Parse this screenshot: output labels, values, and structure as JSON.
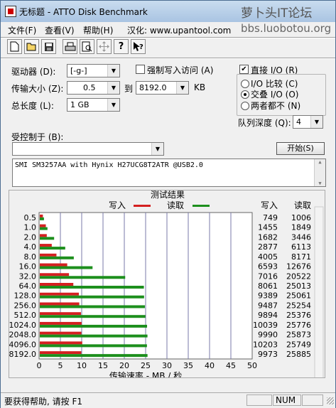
{
  "window": {
    "title": "无标题 - ATTO Disk Benchmark",
    "watermark": "萝卜头IT论坛",
    "watermark_url": "bbs.luobotou.org"
  },
  "menu": [
    "文件(F)",
    "查看(V)",
    "帮助(H)",
    "汉化: www.upantool.com"
  ],
  "toolbar_icons": [
    "new-file-icon",
    "open-folder-icon",
    "save-icon",
    "print-icon",
    "print-preview-icon",
    "move-icon",
    "help-icon",
    "context-help-icon"
  ],
  "form": {
    "drive_label": "驱动器 (D):",
    "drive_value": "[-g-]",
    "force_write_label": "强制写入访问 (A)",
    "force_write_checked": false,
    "direct_io_label": "直接 I/O (R)",
    "direct_io_checked": true,
    "transfer_label": "传输大小 (Z):",
    "transfer_from": "0.5",
    "to_label": "到",
    "transfer_to": "8192.0",
    "kb_label": "KB",
    "length_label": "总长度 (L):",
    "length_value": "1 GB",
    "io_compare_label": "I/O 比较 (C)",
    "overlapped_label": "交叠 I/O (O)",
    "neither_label": "两者都不 (N)",
    "selected_mode": "overlapped",
    "queue_label": "队列深度 (Q):",
    "queue_value": "4",
    "controlled_label": "受控制于 (B):",
    "controlled_value": "",
    "start_button": "开始(S)",
    "description": "SMI SM3257AA with Hynix H27UCG8T2ATR @USB2.0"
  },
  "chart_data": {
    "type": "bar",
    "title": "测试结果",
    "legend": [
      "写入",
      "读取"
    ],
    "colors": {
      "write": "#d42020",
      "read": "#1d8f1d"
    },
    "categories": [
      "0.5",
      "1.0",
      "2.0",
      "4.0",
      "8.0",
      "16.0",
      "32.0",
      "64.0",
      "128.0",
      "256.0",
      "512.0",
      "1024.0",
      "2048.0",
      "4096.0",
      "8192.0"
    ],
    "series": [
      {
        "name": "写入",
        "values": [
          749,
          1455,
          1682,
          2877,
          4005,
          6593,
          7016,
          8061,
          9389,
          9487,
          9894,
          10039,
          9990,
          10203,
          9973
        ]
      },
      {
        "name": "读取",
        "values": [
          1006,
          1849,
          3446,
          6113,
          8171,
          12676,
          20522,
          25013,
          25061,
          25254,
          25376,
          25776,
          25873,
          25749,
          25885
        ]
      }
    ],
    "xlabel": "传输速率 - MB / 秒",
    "xticks": [
      "0",
      "5",
      "10",
      "15",
      "20",
      "25",
      "30",
      "35",
      "40",
      "45",
      "50"
    ],
    "xlim": [
      0,
      50
    ],
    "table_headers": [
      "写入",
      "读取"
    ],
    "units": "KB/s"
  },
  "status": {
    "help_text": "要获得帮助, 请按 F1",
    "num": "NUM"
  }
}
